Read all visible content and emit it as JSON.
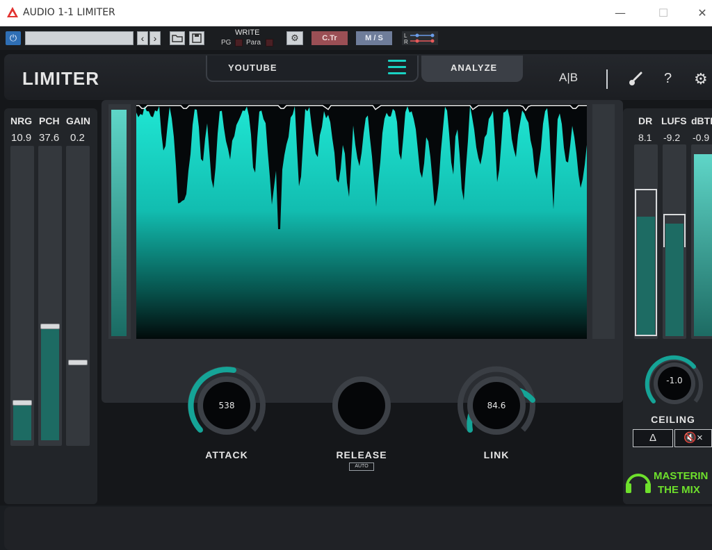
{
  "window": {
    "title": "AUDIO 1-1 LIMITER",
    "minimize": "—",
    "maximize": "☐",
    "close": "✕"
  },
  "host": {
    "power": "⏻",
    "prev": "‹",
    "next": "›",
    "write": "WRITE",
    "pg": "PG",
    "para": "Para",
    "gear": "⚙",
    "ctr": "C.Tr",
    "ms": "M / S",
    "lr_l": "L",
    "lr_r": "R"
  },
  "header": {
    "title": "LIMITER",
    "tab_youtube": "YOUTUBE",
    "tab_analyze": "ANALYZE",
    "ab": "A|B",
    "help": "?",
    "settings": "⚙"
  },
  "left_meters": [
    {
      "label": "NRG",
      "value": "10.9",
      "level": 0.14
    },
    {
      "label": "PCH",
      "value": "37.6",
      "level": 0.38
    },
    {
      "label": "GAIN",
      "value": "0.2",
      "level": 0.28
    }
  ],
  "knobs": {
    "attack": {
      "label": "ATTACK",
      "value": "538",
      "level": 0.62
    },
    "release": {
      "label": "RELEASE",
      "value": "",
      "badge": "AUTO"
    },
    "link": {
      "label": "LINK",
      "value": "84.6",
      "level": 0.55
    }
  },
  "right_meters": [
    {
      "label": "DR",
      "value": "8.1",
      "level": 0.56
    },
    {
      "label": "LUFS",
      "value": "-9.2",
      "level": 0.52
    },
    {
      "label": "dBTP",
      "value": "-0.9",
      "level": 0.96
    }
  ],
  "ceiling": {
    "label": "CEILING",
    "value": "-1.0",
    "delta": "Δ",
    "mute": "🔇×"
  },
  "brand": {
    "line1": "MASTERING",
    "line2": "THE MIX"
  },
  "colors": {
    "accent": "#19d3c3",
    "bg": "#1a1d21"
  }
}
